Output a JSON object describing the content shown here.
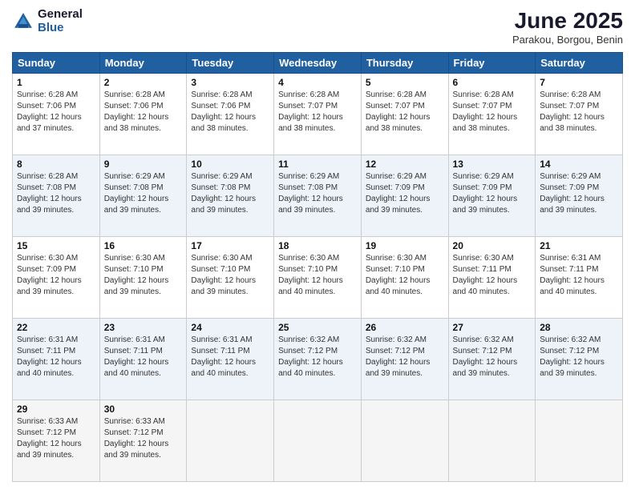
{
  "logo": {
    "general": "General",
    "blue": "Blue"
  },
  "header": {
    "month": "June 2025",
    "location": "Parakou, Borgou, Benin"
  },
  "days_of_week": [
    "Sunday",
    "Monday",
    "Tuesday",
    "Wednesday",
    "Thursday",
    "Friday",
    "Saturday"
  ],
  "weeks": [
    [
      {
        "day": "1",
        "sunrise": "6:28 AM",
        "sunset": "7:06 PM",
        "daylight": "12 hours and 37 minutes."
      },
      {
        "day": "2",
        "sunrise": "6:28 AM",
        "sunset": "7:06 PM",
        "daylight": "12 hours and 38 minutes."
      },
      {
        "day": "3",
        "sunrise": "6:28 AM",
        "sunset": "7:06 PM",
        "daylight": "12 hours and 38 minutes."
      },
      {
        "day": "4",
        "sunrise": "6:28 AM",
        "sunset": "7:07 PM",
        "daylight": "12 hours and 38 minutes."
      },
      {
        "day": "5",
        "sunrise": "6:28 AM",
        "sunset": "7:07 PM",
        "daylight": "12 hours and 38 minutes."
      },
      {
        "day": "6",
        "sunrise": "6:28 AM",
        "sunset": "7:07 PM",
        "daylight": "12 hours and 38 minutes."
      },
      {
        "day": "7",
        "sunrise": "6:28 AM",
        "sunset": "7:07 PM",
        "daylight": "12 hours and 38 minutes."
      }
    ],
    [
      {
        "day": "8",
        "sunrise": "6:28 AM",
        "sunset": "7:08 PM",
        "daylight": "12 hours and 39 minutes."
      },
      {
        "day": "9",
        "sunrise": "6:29 AM",
        "sunset": "7:08 PM",
        "daylight": "12 hours and 39 minutes."
      },
      {
        "day": "10",
        "sunrise": "6:29 AM",
        "sunset": "7:08 PM",
        "daylight": "12 hours and 39 minutes."
      },
      {
        "day": "11",
        "sunrise": "6:29 AM",
        "sunset": "7:08 PM",
        "daylight": "12 hours and 39 minutes."
      },
      {
        "day": "12",
        "sunrise": "6:29 AM",
        "sunset": "7:09 PM",
        "daylight": "12 hours and 39 minutes."
      },
      {
        "day": "13",
        "sunrise": "6:29 AM",
        "sunset": "7:09 PM",
        "daylight": "12 hours and 39 minutes."
      },
      {
        "day": "14",
        "sunrise": "6:29 AM",
        "sunset": "7:09 PM",
        "daylight": "12 hours and 39 minutes."
      }
    ],
    [
      {
        "day": "15",
        "sunrise": "6:30 AM",
        "sunset": "7:09 PM",
        "daylight": "12 hours and 39 minutes."
      },
      {
        "day": "16",
        "sunrise": "6:30 AM",
        "sunset": "7:10 PM",
        "daylight": "12 hours and 39 minutes."
      },
      {
        "day": "17",
        "sunrise": "6:30 AM",
        "sunset": "7:10 PM",
        "daylight": "12 hours and 39 minutes."
      },
      {
        "day": "18",
        "sunrise": "6:30 AM",
        "sunset": "7:10 PM",
        "daylight": "12 hours and 40 minutes."
      },
      {
        "day": "19",
        "sunrise": "6:30 AM",
        "sunset": "7:10 PM",
        "daylight": "12 hours and 40 minutes."
      },
      {
        "day": "20",
        "sunrise": "6:30 AM",
        "sunset": "7:11 PM",
        "daylight": "12 hours and 40 minutes."
      },
      {
        "day": "21",
        "sunrise": "6:31 AM",
        "sunset": "7:11 PM",
        "daylight": "12 hours and 40 minutes."
      }
    ],
    [
      {
        "day": "22",
        "sunrise": "6:31 AM",
        "sunset": "7:11 PM",
        "daylight": "12 hours and 40 minutes."
      },
      {
        "day": "23",
        "sunrise": "6:31 AM",
        "sunset": "7:11 PM",
        "daylight": "12 hours and 40 minutes."
      },
      {
        "day": "24",
        "sunrise": "6:31 AM",
        "sunset": "7:11 PM",
        "daylight": "12 hours and 40 minutes."
      },
      {
        "day": "25",
        "sunrise": "6:32 AM",
        "sunset": "7:12 PM",
        "daylight": "12 hours and 40 minutes."
      },
      {
        "day": "26",
        "sunrise": "6:32 AM",
        "sunset": "7:12 PM",
        "daylight": "12 hours and 39 minutes."
      },
      {
        "day": "27",
        "sunrise": "6:32 AM",
        "sunset": "7:12 PM",
        "daylight": "12 hours and 39 minutes."
      },
      {
        "day": "28",
        "sunrise": "6:32 AM",
        "sunset": "7:12 PM",
        "daylight": "12 hours and 39 minutes."
      }
    ],
    [
      {
        "day": "29",
        "sunrise": "6:33 AM",
        "sunset": "7:12 PM",
        "daylight": "12 hours and 39 minutes."
      },
      {
        "day": "30",
        "sunrise": "6:33 AM",
        "sunset": "7:12 PM",
        "daylight": "12 hours and 39 minutes."
      },
      null,
      null,
      null,
      null,
      null
    ]
  ]
}
